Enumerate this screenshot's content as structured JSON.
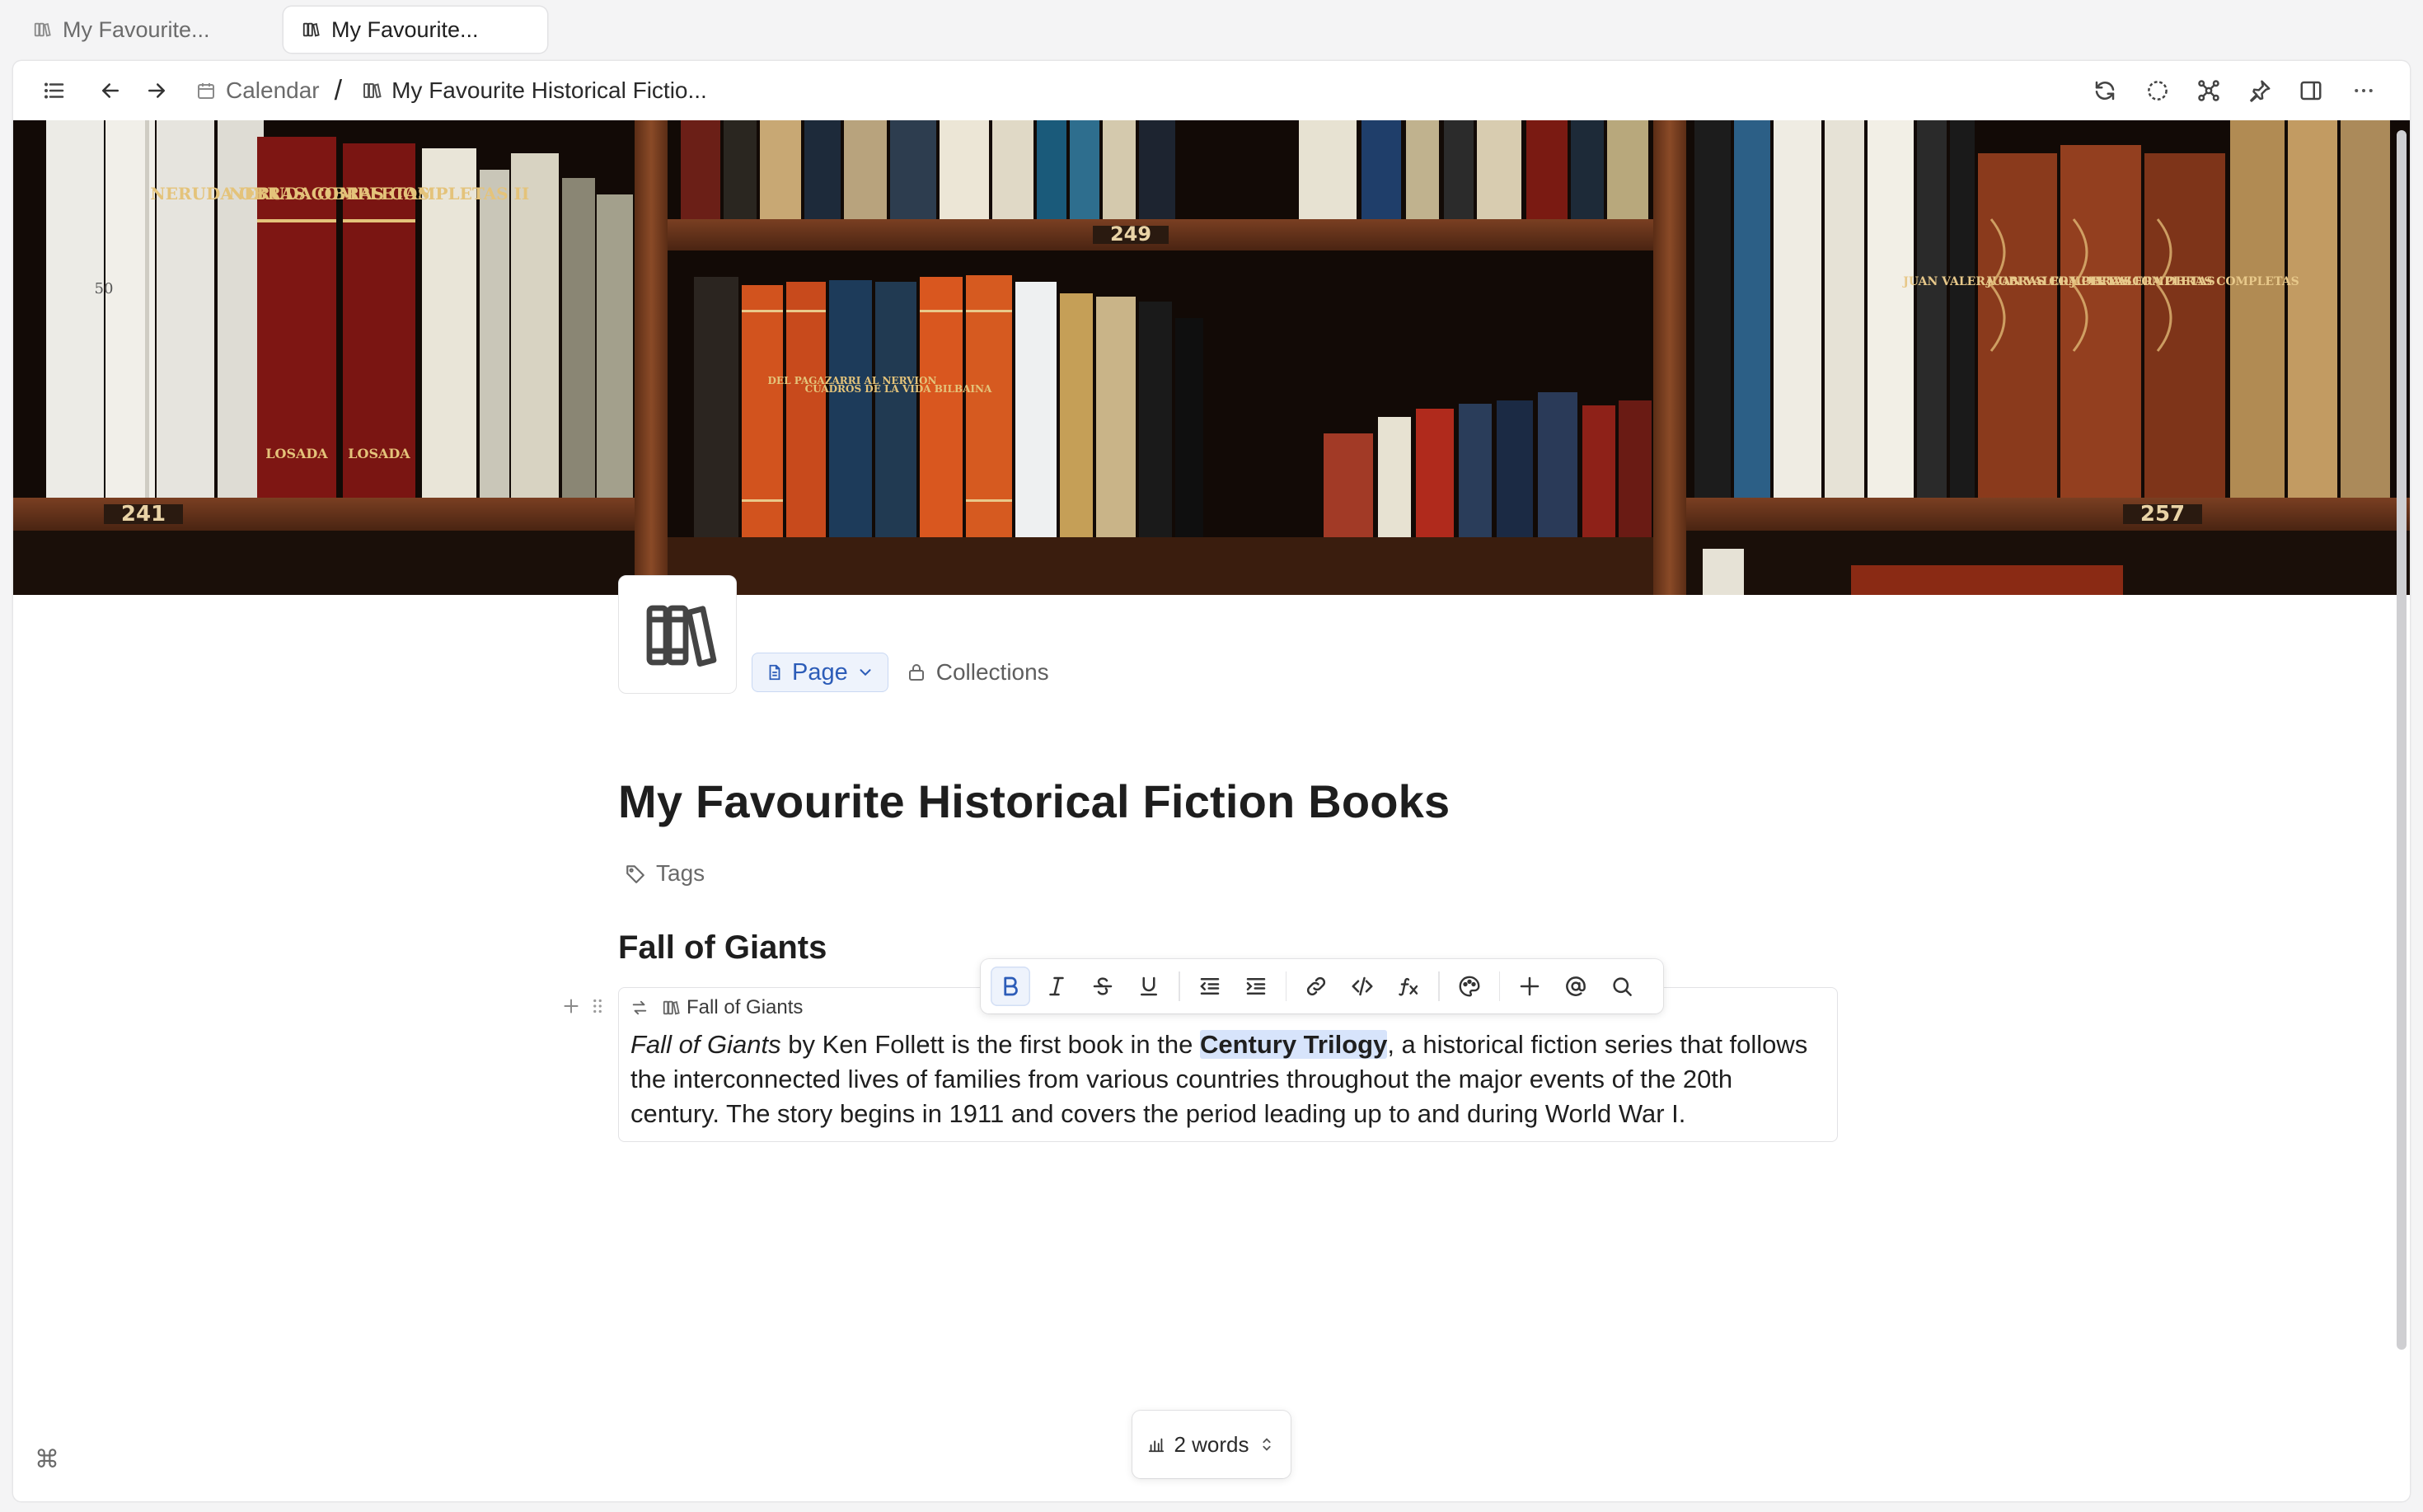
{
  "tabs": [
    {
      "label": "My Favourite...",
      "icon": "books-icon",
      "active": false
    },
    {
      "label": "My Favourite...",
      "icon": "books-icon",
      "active": true
    }
  ],
  "header": {
    "icons": [
      "sidebar-toggle-icon",
      "back-arrow-icon",
      "forward-arrow-icon",
      "sync-icon",
      "focus-icon",
      "graph-icon",
      "pin-icon",
      "split-view-icon",
      "more-icon"
    ],
    "breadcrumb": [
      {
        "label": "Calendar",
        "icon": "calendar-icon"
      },
      {
        "label": "My Favourite Historical Fictio...",
        "icon": "books-icon"
      }
    ],
    "separator": "/"
  },
  "page": {
    "type_label": "Page",
    "collections_label": "Collections",
    "title": "My Favourite Historical Fiction Books",
    "tags_label": "Tags",
    "heading": "Fall of Giants"
  },
  "banner": {
    "shelf_labels": [
      "249",
      "241",
      "257"
    ],
    "spine_texts": [
      "NERUDA OBRAS COMPLETAS I",
      "NERUDA OBRAS COMPLETAS II",
      "LOSADA",
      "LOSADA",
      "50",
      "DEL PAGAZARRI AL NERVION",
      "CUADROS DE LA VIDA BILBAINA",
      "JUAN VALERA OBRAS COMPLETAS",
      "JUAN VALERA OBRAS COMPLETAS",
      "JUAN VALERA OBRAS COMPLETAS"
    ]
  },
  "block": {
    "embed_label": "Fall of Giants",
    "text_italic": "Fall of Giants",
    "text_1": " by Ken Follett is the first book in the ",
    "text_highlight": "Century Trilogy",
    "text_2": ", a historical fiction series that follows the interconnected lives of families from various countries throughout the major events of the 20th century. The story begins in 1911 and covers the period leading up to and during World War I."
  },
  "toolbar": {
    "buttons": [
      "bold-icon",
      "italic-icon",
      "strikethrough-icon",
      "underline-icon",
      "outdent-icon",
      "indent-icon",
      "link-icon",
      "code-icon",
      "formula-icon",
      "palette-icon",
      "plus-icon",
      "mention-icon",
      "search-icon"
    ],
    "active": "bold-icon"
  },
  "status": {
    "word_count": "2 words",
    "command_symbol": "⌘"
  },
  "colors": {
    "accent": "#2c5cb8",
    "highlight": "#d7e4fb"
  }
}
